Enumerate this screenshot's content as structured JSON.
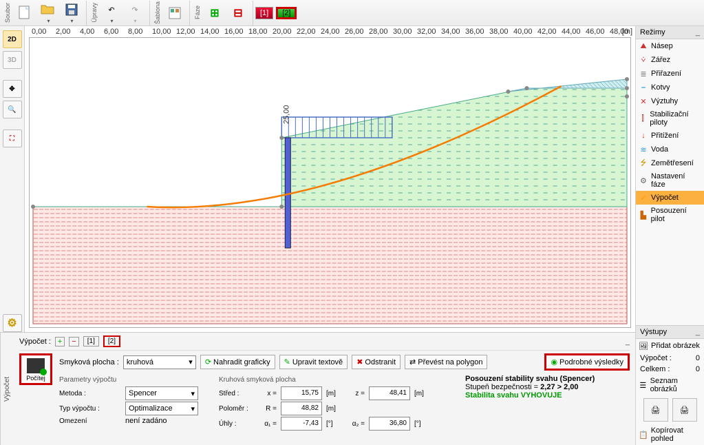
{
  "toolbar": {
    "groups": {
      "file": "Soubor",
      "edit": "Úpravy",
      "template": "Šablona",
      "phase": "Fáze"
    },
    "phases": {
      "p1": "[1]",
      "p2": "[2]"
    }
  },
  "ruler": {
    "ticks": [
      "0,00",
      "2,00",
      "4,00",
      "6,00",
      "8,00",
      "10,00",
      "12,00",
      "14,00",
      "16,00",
      "18,00",
      "20,00",
      "22,00",
      "24,00",
      "26,00",
      "28,00",
      "30,00",
      "32,00",
      "34,00",
      "36,00",
      "38,00",
      "40,00",
      "42,00",
      "44,00",
      "46,00",
      "48,00"
    ],
    "unit": "[m]",
    "load_label": "25,00"
  },
  "left_sidebar": {
    "b2d": "2D",
    "b3d": "3D"
  },
  "modes": {
    "title": "Režimy",
    "items": [
      {
        "icon": "⛰",
        "label": "Násep",
        "color": "#c33"
      },
      {
        "icon": "⩒",
        "label": "Zářez",
        "color": "#c33"
      },
      {
        "icon": "≣",
        "label": "Přiřazení",
        "color": "#888"
      },
      {
        "icon": "⎯",
        "label": "Kotvy",
        "color": "#08c"
      },
      {
        "icon": "✕",
        "label": "Výztuhy",
        "color": "#c33"
      },
      {
        "icon": "⫿",
        "label": "Stabilizační piloty",
        "color": "#933"
      },
      {
        "icon": "↓",
        "label": "Přitížení",
        "color": "#c33"
      },
      {
        "icon": "≋",
        "label": "Voda",
        "color": "#39c"
      },
      {
        "icon": "⭍",
        "label": "Zemětřesení",
        "color": "#c90"
      },
      {
        "icon": "⚙",
        "label": "Nastavení fáze",
        "color": "#666"
      },
      {
        "icon": "✓",
        "label": "Výpočet",
        "color": "#f90",
        "active": true
      },
      {
        "icon": "▙",
        "label": "Posouzení pilot",
        "color": "#c60"
      }
    ]
  },
  "outputs": {
    "title": "Výstupy",
    "add_image": "Přidat obrázek",
    "line1_label": "Výpočet :",
    "line1_val": "0",
    "line2_label": "Celkem :",
    "line2_val": "0",
    "list_images": "Seznam obrázků",
    "copy_view": "Kopírovat pohled"
  },
  "bottom": {
    "tab_label": "Výpočet",
    "row_top": {
      "label": "Výpočet :",
      "p1": "[1]",
      "p2": "[2]"
    },
    "calc_button": "Počítej",
    "slip_label": "Smyková plocha :",
    "slip_type": "kruhová",
    "actions": {
      "replace": "Nahradit graficky",
      "edit": "Upravit textově",
      "remove": "Odstranit",
      "convert": "Převést na polygon",
      "detailed": "Podrobné výsledky"
    },
    "section1": "Parametry výpočtu",
    "section2": "Kruhová smyková plocha",
    "method_label": "Metoda :",
    "method": "Spencer",
    "calc_type_label": "Typ výpočtu :",
    "calc_type": "Optimalizace",
    "constraint_label": "Omezení",
    "constraint_val": "není zadáno",
    "center_label": "Střed :",
    "x_label": "x =",
    "x_val": "15,75",
    "z_label": "z =",
    "z_val": "48,41",
    "radius_label": "Poloměr :",
    "r_label": "R =",
    "r_val": "48,82",
    "angles_label": "Úhly :",
    "a1_label": "α₁ =",
    "a1_val": "-7,43",
    "a2_label": "α₂ =",
    "a2_val": "36,80",
    "unit_m": "[m]",
    "unit_deg": "[°]",
    "result": {
      "title": "Posouzení stability svahu (Spencer)",
      "line2a": "Stupeň bezpečnosti = ",
      "line2b": "2,27 > 2,00",
      "line3": "Stabilita svahu VYHOVUJE"
    }
  }
}
